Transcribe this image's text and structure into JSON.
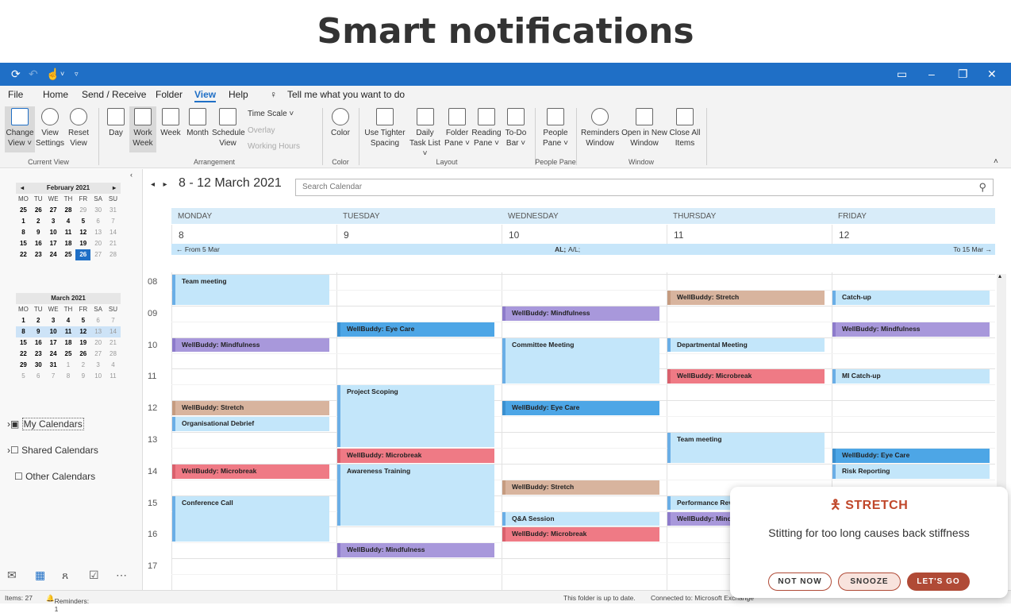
{
  "headline": "Smart notifications",
  "titlebar": {
    "icons": [
      "sync-icon",
      "undo-icon",
      "touch-icon",
      "dropdown-icon"
    ],
    "controls": [
      "▭",
      "–",
      "❐",
      "✕"
    ]
  },
  "menu": [
    "File",
    "Home",
    "Send / Receive",
    "Folder",
    "View",
    "Help"
  ],
  "menu_active": "View",
  "tell_me": "Tell me what you want to do",
  "ribbon": {
    "change_view": "Change View ˅",
    "view_settings": "View Settings",
    "reset_view": "Reset View",
    "group_current_view": "Current View",
    "day": "Day",
    "work_week": "Work Week",
    "week": "Week",
    "month": "Month",
    "schedule_view": "Schedule View",
    "time_scale": "Time Scale ˅",
    "overlay": "Overlay",
    "working_hours": "Working Hours",
    "group_arrangement": "Arrangement",
    "color": "Color",
    "group_color": "Color",
    "tighter_spacing": "Use Tighter Spacing",
    "daily_task_list": "Daily Task List ˅",
    "folder_pane": "Folder Pane ˅",
    "reading_pane": "Reading Pane ˅",
    "todo_bar": "To-Do Bar ˅",
    "group_layout": "Layout",
    "people_pane": "People Pane ˅",
    "group_people_pane": "People Pane",
    "reminders_window": "Reminders Window",
    "open_new_window": "Open in New Window",
    "close_all_items": "Close All Items",
    "group_window": "Window"
  },
  "mini_cal": {
    "feb": {
      "title": "February 2021",
      "weekdays": [
        "MO",
        "TU",
        "WE",
        "TH",
        "FR",
        "SA",
        "SU"
      ],
      "rows": [
        [
          "25",
          "26",
          "27",
          "28",
          "29",
          "30",
          "31"
        ],
        [
          "1",
          "2",
          "3",
          "4",
          "5",
          "6",
          "7"
        ],
        [
          "8",
          "9",
          "10",
          "11",
          "12",
          "13",
          "14"
        ],
        [
          "15",
          "16",
          "17",
          "18",
          "19",
          "20",
          "21"
        ],
        [
          "22",
          "23",
          "24",
          "25",
          "26",
          "27",
          "28"
        ]
      ]
    },
    "mar": {
      "title": "March 2021",
      "weekdays": [
        "MO",
        "TU",
        "WE",
        "TH",
        "FR",
        "SA",
        "SU"
      ],
      "rows": [
        [
          "1",
          "2",
          "3",
          "4",
          "5",
          "6",
          "7"
        ],
        [
          "8",
          "9",
          "10",
          "11",
          "12",
          "13",
          "14"
        ],
        [
          "15",
          "16",
          "17",
          "18",
          "19",
          "20",
          "21"
        ],
        [
          "22",
          "23",
          "24",
          "25",
          "26",
          "27",
          "28"
        ],
        [
          "29",
          "30",
          "31",
          "1",
          "2",
          "3",
          "4"
        ],
        [
          "5",
          "6",
          "7",
          "8",
          "9",
          "10",
          "11"
        ]
      ]
    }
  },
  "calendar_groups": {
    "my": "My Calendars",
    "shared": "Shared Calendars",
    "other": "Other Calendars"
  },
  "bottom_nav": [
    "mail-icon",
    "calendar-icon",
    "people-icon",
    "tasks-icon",
    "more-icon"
  ],
  "date_range": "8 - 12 March 2021",
  "search_placeholder": "Search Calendar",
  "days": [
    {
      "name": "MONDAY",
      "num": "8"
    },
    {
      "name": "TUESDAY",
      "num": "9"
    },
    {
      "name": "WEDNESDAY",
      "num": "10"
    },
    {
      "name": "THURSDAY",
      "num": "11"
    },
    {
      "name": "FRIDAY",
      "num": "12"
    }
  ],
  "allday": {
    "from": "← From 5 Mar",
    "label": "AL;",
    "sub": "A/L;",
    "to": "To 15 Mar →"
  },
  "hours": [
    "08",
    "09",
    "10",
    "11",
    "12",
    "13",
    "14",
    "15",
    "16",
    "17"
  ],
  "events": [
    {
      "day": 0,
      "start": 8.0,
      "end": 9.0,
      "title": "Team meeting",
      "color": "blue"
    },
    {
      "day": 0,
      "start": 10.0,
      "end": 10.5,
      "title": "WellBuddy: Mindfulness",
      "color": "purple"
    },
    {
      "day": 0,
      "start": 12.0,
      "end": 12.5,
      "title": "WellBuddy: Stretch",
      "color": "tan"
    },
    {
      "day": 0,
      "start": 12.5,
      "end": 13.0,
      "title": "Organisational Debrief",
      "color": "blue"
    },
    {
      "day": 0,
      "start": 14.0,
      "end": 14.5,
      "title": "WellBuddy: Microbreak",
      "color": "red"
    },
    {
      "day": 0,
      "start": 15.0,
      "end": 16.5,
      "title": "Conference Call",
      "color": "blue"
    },
    {
      "day": 1,
      "start": 9.5,
      "end": 10.0,
      "title": "WellBuddy: Eye Care",
      "color": "eye"
    },
    {
      "day": 1,
      "start": 11.5,
      "end": 13.5,
      "title": "Project Scoping",
      "color": "blue"
    },
    {
      "day": 1,
      "start": 13.5,
      "end": 14.0,
      "title": "WellBuddy: Microbreak",
      "color": "red"
    },
    {
      "day": 1,
      "start": 14.0,
      "end": 16.0,
      "title": "Awareness Training",
      "color": "blue"
    },
    {
      "day": 1,
      "start": 16.5,
      "end": 17.0,
      "title": "WellBuddy: Mindfulness",
      "color": "purple"
    },
    {
      "day": 2,
      "start": 9.0,
      "end": 9.5,
      "title": "WellBuddy: Mindfulness",
      "color": "purple"
    },
    {
      "day": 2,
      "start": 10.0,
      "end": 11.5,
      "title": "Committee Meeting",
      "color": "blue"
    },
    {
      "day": 2,
      "start": 12.0,
      "end": 12.5,
      "title": "WellBuddy: Eye Care",
      "color": "eye"
    },
    {
      "day": 2,
      "start": 14.5,
      "end": 15.0,
      "title": "WellBuddy: Stretch",
      "color": "tan"
    },
    {
      "day": 2,
      "start": 15.5,
      "end": 16.0,
      "title": "Q&A Session",
      "color": "blue"
    },
    {
      "day": 2,
      "start": 16.0,
      "end": 16.5,
      "title": "WellBuddy: Microbreak",
      "color": "red"
    },
    {
      "day": 3,
      "start": 8.5,
      "end": 9.0,
      "title": "WellBuddy: Stretch",
      "color": "tan"
    },
    {
      "day": 3,
      "start": 10.0,
      "end": 10.5,
      "title": "Departmental Meeting",
      "color": "blue"
    },
    {
      "day": 3,
      "start": 11.0,
      "end": 11.5,
      "title": "WellBuddy: Microbreak",
      "color": "red"
    },
    {
      "day": 3,
      "start": 13.0,
      "end": 14.0,
      "title": "Team meeting",
      "color": "blue"
    },
    {
      "day": 3,
      "start": 15.0,
      "end": 15.5,
      "title": "Performance Review",
      "color": "blue"
    },
    {
      "day": 3,
      "start": 15.5,
      "end": 16.0,
      "title": "WellBuddy: Mindfulness",
      "color": "purple"
    },
    {
      "day": 4,
      "start": 8.5,
      "end": 9.0,
      "title": "Catch-up",
      "color": "blue"
    },
    {
      "day": 4,
      "start": 9.5,
      "end": 10.0,
      "title": "WellBuddy: Mindfulness",
      "color": "purple"
    },
    {
      "day": 4,
      "start": 11.0,
      "end": 11.5,
      "title": "MI Catch-up",
      "color": "blue"
    },
    {
      "day": 4,
      "start": 13.5,
      "end": 14.0,
      "title": "WellBuddy: Eye Care",
      "color": "eye"
    },
    {
      "day": 4,
      "start": 14.0,
      "end": 14.5,
      "title": "Risk Reporting",
      "color": "blue"
    }
  ],
  "status": {
    "items": "Items: 27",
    "reminders": "Reminders: 1",
    "uptodate": "This folder is up to date.",
    "connected": "Connected to: Microsoft Exchange"
  },
  "toast": {
    "title": "STRETCH",
    "message": "Stitting for too long causes back stiffness",
    "not_now": "NOT NOW",
    "snooze": "SNOOZE",
    "go": "LET'S GO",
    "accent": "#c0472a"
  }
}
